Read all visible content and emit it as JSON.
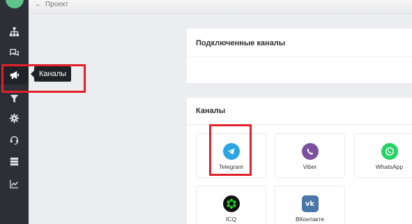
{
  "topbar": {
    "back_arrow": "←",
    "breadcrumb": "Проект"
  },
  "sidebar": {
    "items": [
      {
        "icon": "hierarchy-icon"
      },
      {
        "icon": "chat-icon"
      },
      {
        "icon": "megaphone-icon",
        "active": true
      },
      {
        "icon": "filter-icon"
      },
      {
        "icon": "gear-icon"
      },
      {
        "icon": "headset-icon"
      },
      {
        "icon": "database-icon"
      },
      {
        "icon": "chart-icon"
      }
    ]
  },
  "tooltip": {
    "label": "Каналы"
  },
  "connected_panel": {
    "title": "Подключенные каналы"
  },
  "channels_panel": {
    "title": "Каналы",
    "channels": [
      {
        "label": "Telegram",
        "color": "#2ca5e0"
      },
      {
        "label": "Viber",
        "color": "#7b519d"
      },
      {
        "label": "WhatsApp",
        "color": "#25d366"
      },
      {
        "label": "ICQ",
        "color": "#24ce2c"
      },
      {
        "label": "ВКонтакте",
        "color": "#4a76a8"
      }
    ]
  },
  "colors": {
    "sidebar": "#2c3036",
    "highlight": "#e3202a",
    "background": "#ebedf0"
  }
}
